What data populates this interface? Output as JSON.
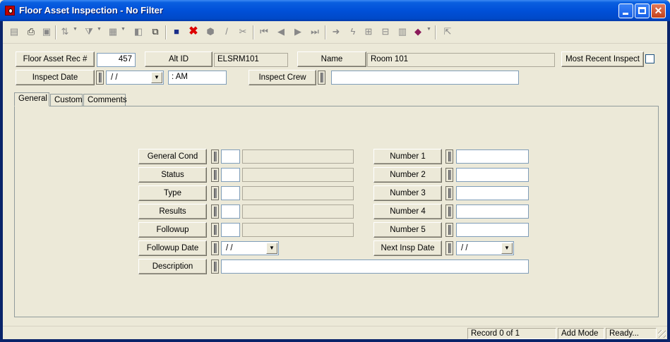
{
  "window": {
    "title": "Floor Asset Inspection - No Filter"
  },
  "toolbar": {
    "icons": [
      "form-view-icon",
      "print-icon",
      "print-preview-icon",
      "sort-icon",
      "filter-icon",
      "report-icon",
      "properties-icon",
      "copy-record-icon",
      "save-icon",
      "delete-icon",
      "find-icon",
      "edit-icon",
      "cut-icon",
      "first-record-icon",
      "previous-record-icon",
      "next-record-icon",
      "last-record-icon",
      "goto-icon",
      "quick-icon",
      "tree-icon",
      "hierarchy-icon",
      "calculator-icon",
      "book-icon",
      "export-icon"
    ]
  },
  "header": {
    "rec_label": "Floor Asset Rec #",
    "rec_value": "457",
    "alt_id_label": "Alt ID",
    "alt_id_value": "ELSRM101",
    "name_label": "Name",
    "name_value": "Room 101",
    "most_recent_label": "Most Recent Inspect",
    "inspect_date_label": "Inspect Date",
    "inspect_date_value": " /  /",
    "inspect_time_value": " :  AM",
    "inspect_crew_label": "Inspect Crew",
    "inspect_crew_value": ""
  },
  "tabs": [
    "General",
    "Custom",
    "Comments"
  ],
  "general": {
    "left": [
      {
        "label": "General Cond",
        "code": "",
        "desc": ""
      },
      {
        "label": "Status",
        "code": "",
        "desc": ""
      },
      {
        "label": "Type",
        "code": "",
        "desc": ""
      },
      {
        "label": "Results",
        "code": "",
        "desc": ""
      },
      {
        "label": "Followup",
        "code": "",
        "desc": ""
      }
    ],
    "followup_date_label": "Followup Date",
    "followup_date_value": " /  /",
    "description_label": "Description",
    "description_value": "",
    "right": [
      {
        "label": "Number 1",
        "value": ""
      },
      {
        "label": "Number 2",
        "value": ""
      },
      {
        "label": "Number 3",
        "value": ""
      },
      {
        "label": "Number 4",
        "value": ""
      },
      {
        "label": "Number 5",
        "value": ""
      }
    ],
    "next_insp_label": "Next Insp Date",
    "next_insp_value": " /  /"
  },
  "status": {
    "record": "Record 0 of 1",
    "mode": "Add Mode",
    "state": "Ready..."
  }
}
